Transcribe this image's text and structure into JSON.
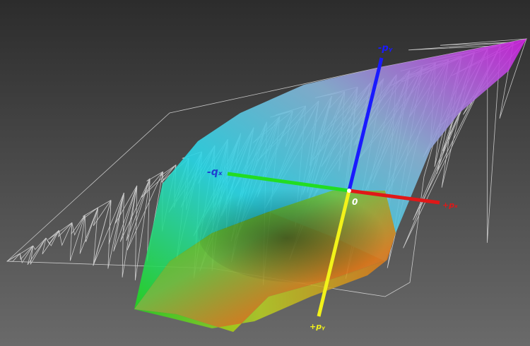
{
  "viewer": {
    "background_top": "#2c2c2c",
    "background_bottom": "#6a6a6a",
    "wireframe_color": "#e8e8e8"
  },
  "axes": {
    "minus_py": {
      "label": "-pᵧ",
      "color": "#1a1aff"
    },
    "minus_qx": {
      "label": "-qₓ",
      "color": "#1f3fd0",
      "line_color": "#22dd22"
    },
    "plus_px": {
      "label": "+pₓ",
      "color": "#e01818"
    },
    "plus_py": {
      "label": "+pᵧ",
      "color": "#f2f21a"
    },
    "origin": {
      "label": "0",
      "color": "#ffffff"
    }
  },
  "surface": {
    "colors": {
      "magenta": "#d020e0",
      "cyan": "#28d8e8",
      "green": "#22d81a",
      "yellow": "#d8c81a",
      "orange": "#e07a1a",
      "gray": "#9a9a9a"
    }
  }
}
